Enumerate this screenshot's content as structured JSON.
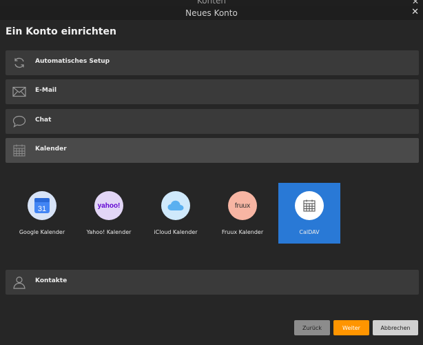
{
  "background_window": {
    "title": "Konten",
    "close_glyph": "✕"
  },
  "dialog": {
    "title": "Neues Konto",
    "close_glyph": "✕",
    "heading": "Ein Konto einrichten"
  },
  "options": [
    {
      "label": "Automatisches Setup",
      "icon": "refresh-icon"
    },
    {
      "label": "E-Mail",
      "icon": "envelope-icon"
    },
    {
      "label": "Chat",
      "icon": "speech-bubble-icon"
    },
    {
      "label": "Kalender",
      "icon": "calendar-icon",
      "selected": true
    },
    {
      "label": "Kontakte",
      "icon": "person-icon"
    }
  ],
  "calendar_providers": [
    {
      "label": "Google Kalender",
      "icon": "google-calendar-icon",
      "icon_text": "31",
      "color": "#4285f4"
    },
    {
      "label": "Yahoo! Kalender",
      "icon": "yahoo-icon",
      "icon_text": "yahoo!",
      "color": "#6001d2"
    },
    {
      "label": "iCloud Kalender",
      "icon": "icloud-icon",
      "color": "#5ab0f0"
    },
    {
      "label": "Fruux Kalender",
      "icon": "fruux-icon",
      "icon_text": "fruux",
      "color": "#f7b5a3"
    },
    {
      "label": "CalDAV",
      "icon": "caldav-calendar-icon",
      "selected": true,
      "color": "#2979d6"
    }
  ],
  "buttons": {
    "back": "Zurück",
    "next": "Weiter",
    "cancel": "Abbrechen"
  },
  "colors": {
    "accent_orange": "#ff9500",
    "selection_blue": "#2979d6",
    "row_bg": "#3a3a3a"
  }
}
